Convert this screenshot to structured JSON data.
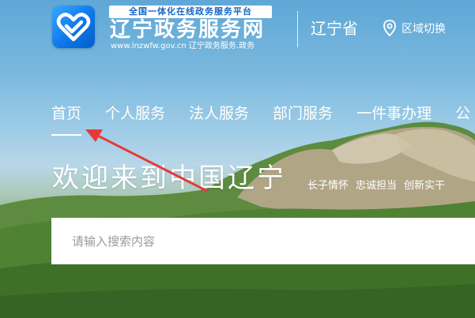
{
  "header": {
    "tagline": "全国一体化在线政务服务平台",
    "title": "辽宁政务服务网",
    "url": "www.lnzwfw.gov.cn  辽宁政务服务.政务",
    "province": "辽宁省",
    "region_switch": "区域切换"
  },
  "nav": {
    "items": [
      {
        "label": "首页",
        "active": true
      },
      {
        "label": "个人服务"
      },
      {
        "label": "法人服务"
      },
      {
        "label": "部门服务"
      },
      {
        "label": "一件事办理"
      },
      {
        "label": "公"
      }
    ]
  },
  "hero": {
    "welcome": "欢迎来到中国辽宁",
    "slogans": [
      "长子情怀",
      "忠诚担当",
      "创新实干"
    ]
  },
  "search": {
    "placeholder": "请输入搜索内容"
  },
  "colors": {
    "brand_blue": "#0a74e6",
    "annotation_red": "#e8393a"
  }
}
